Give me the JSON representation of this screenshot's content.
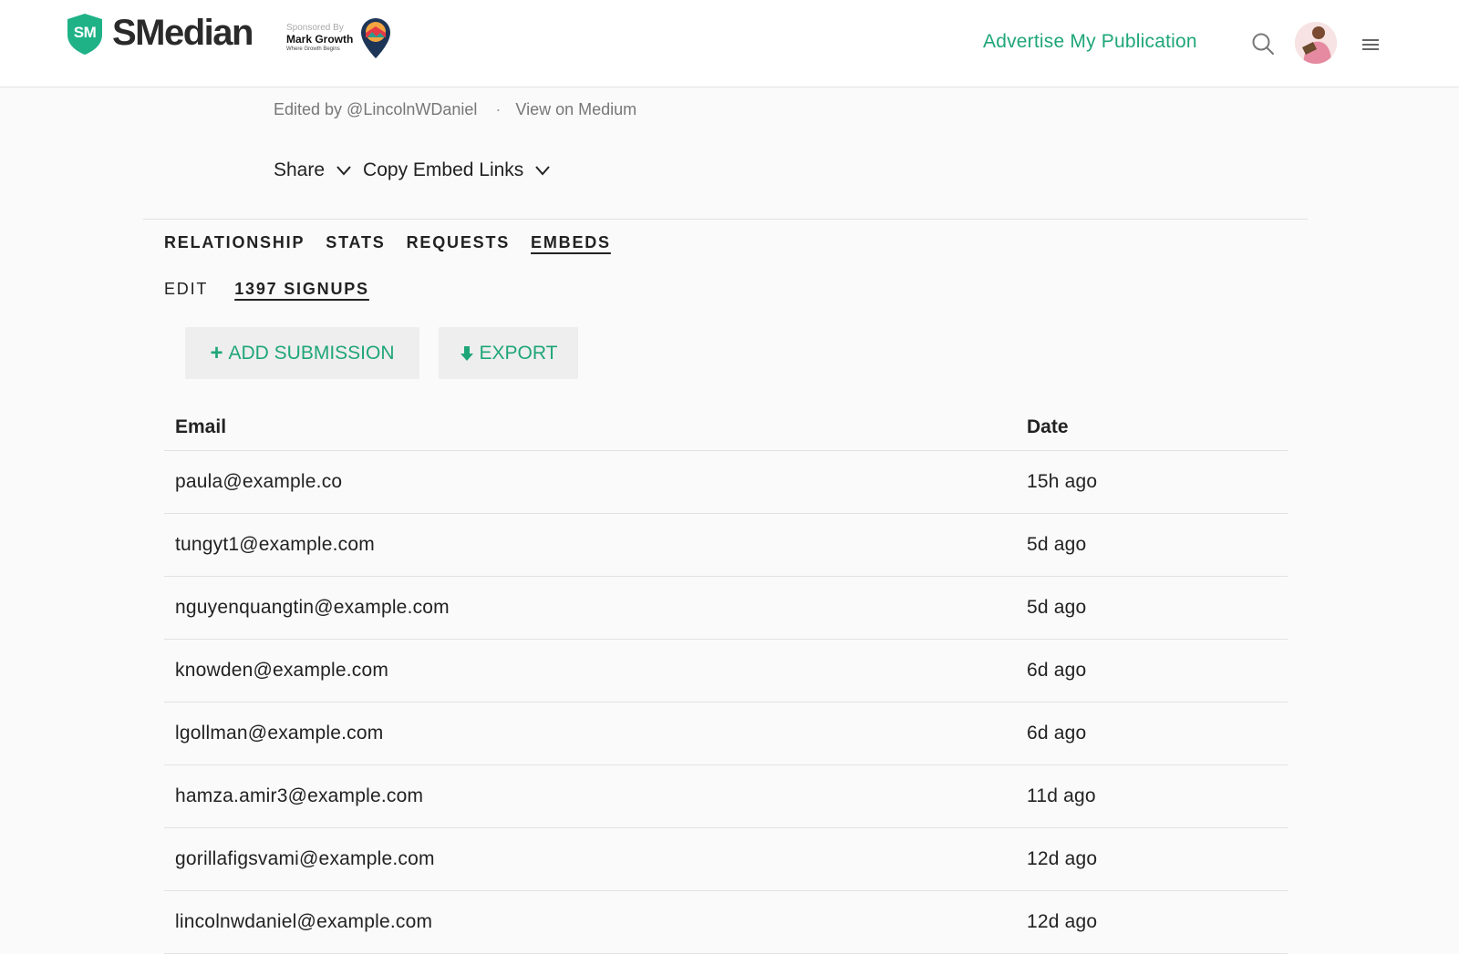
{
  "header": {
    "logo_initials": "SM",
    "brand": "SMedian",
    "sponsor": {
      "line1": "Sponsored By",
      "line2": "Mark Growth",
      "line3": "Where Growth Begins"
    },
    "advertise_link": "Advertise My Publication",
    "icons": [
      "search-icon",
      "avatar",
      "menu-icon"
    ]
  },
  "publication": {
    "edited_by": "Edited by @LincolnWDaniel",
    "separator": "·",
    "view_on_medium": "View on Medium",
    "share_label": "Share",
    "copy_embed_label": "Copy Embed Links"
  },
  "tabs": [
    {
      "label": "RELATIONSHIP",
      "active": false
    },
    {
      "label": "STATS",
      "active": false
    },
    {
      "label": "REQUESTS",
      "active": false
    },
    {
      "label": "EMBEDS",
      "active": true
    }
  ],
  "subtabs": [
    {
      "label": "EDIT",
      "active": false
    },
    {
      "label": "1397 SIGNUPS",
      "active": true
    }
  ],
  "actions": {
    "add_submission_icon": "+",
    "add_submission": "ADD SUBMISSION",
    "export": "EXPORT"
  },
  "table": {
    "headers": [
      "Email",
      "Date"
    ],
    "rows": [
      [
        "paula@example.co",
        "15h ago"
      ],
      [
        "tungyt1@example.com",
        "5d ago"
      ],
      [
        "nguyenquangtin@example.com",
        "5d ago"
      ],
      [
        "knowden@example.com",
        "6d ago"
      ],
      [
        "lgollman@example.com",
        "6d ago"
      ],
      [
        "hamza.amir3@example.com",
        "11d ago"
      ],
      [
        "gorillafigsvami@example.com",
        "12d ago"
      ],
      [
        "lincolnwdaniel@example.com",
        "12d ago"
      ]
    ]
  },
  "colors": {
    "accent": "#1fa678",
    "header_bg": "#ffffff",
    "page_bg": "#fafafa",
    "button_bg": "#eeeeee"
  }
}
